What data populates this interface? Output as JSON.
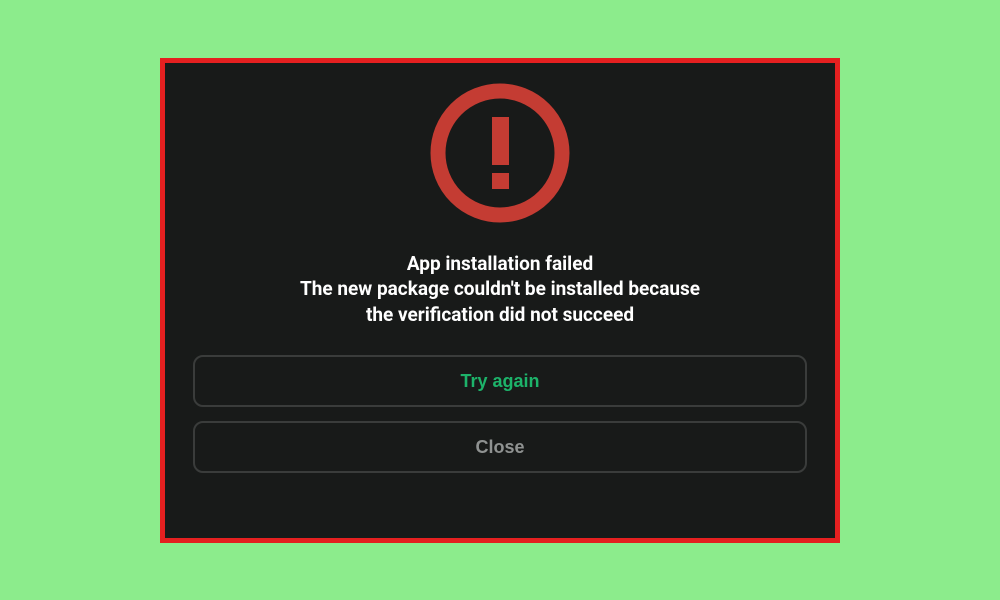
{
  "dialog": {
    "title": "App installation failed",
    "message_line1": "The new package couldn't be installed because",
    "message_line2": "the verification did not succeed",
    "try_again_label": "Try again",
    "close_label": "Close"
  },
  "colors": {
    "accent_error": "#c43c33",
    "button_primary_text": "#1db36a",
    "button_secondary_text": "#8f9291"
  }
}
